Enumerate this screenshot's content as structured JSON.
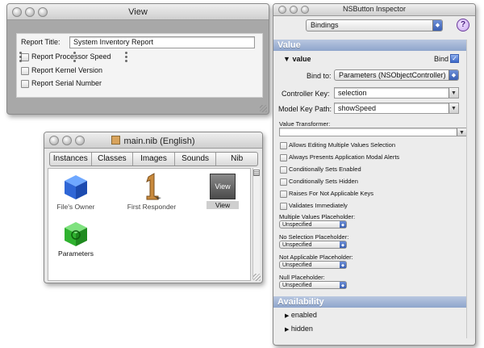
{
  "view_window": {
    "title": "View",
    "report_title_label": "Report Title:",
    "report_title_value": "System Inventory Report",
    "checkboxes": [
      {
        "label": "Report Processor Speed"
      },
      {
        "label": "Report Kernel Version"
      },
      {
        "label": "Report Serial Number"
      }
    ]
  },
  "nib_window": {
    "title": "main.nib (English)",
    "tabs": [
      "Instances",
      "Classes",
      "Images",
      "Sounds",
      "Nib"
    ],
    "items": [
      {
        "label": "File's Owner",
        "icon": "cube-icon"
      },
      {
        "label": "First Responder",
        "icon": "number-one-icon"
      },
      {
        "label": "View",
        "icon": "view-icon"
      },
      {
        "label": "Parameters",
        "icon": "green-cube-icon"
      }
    ]
  },
  "inspector": {
    "title": "NSButton Inspector",
    "popup": "Bindings",
    "help": "?",
    "section_value": "Value",
    "binding_name": "value",
    "bind_label": "Bind",
    "bind_to_label": "Bind to:",
    "bind_to_value": "Parameters (NSObjectController)",
    "controller_key_label": "Controller Key:",
    "controller_key_value": "selection",
    "model_key_path_label": "Model Key Path:",
    "model_key_path_value": "showSpeed",
    "value_transformer_label": "Value Transformer:",
    "options": [
      "Allows Editing Multiple Values Selection",
      "Always Presents Application Modal Alerts",
      "Conditionally Sets Enabled",
      "Conditionally Sets Hidden",
      "Raises For Not Applicable Keys",
      "Validates Immediately"
    ],
    "placeholders": [
      {
        "label": "Multiple Values Placeholder:",
        "value": "Unspecified"
      },
      {
        "label": "No Selection Placeholder:",
        "value": "Unspecified"
      },
      {
        "label": "Not Applicable Placeholder:",
        "value": "Unspecified"
      },
      {
        "label": "Null Placeholder:",
        "value": "Unspecified"
      }
    ],
    "section_availability": "Availability",
    "availability_items": [
      "enabled",
      "hidden"
    ]
  }
}
